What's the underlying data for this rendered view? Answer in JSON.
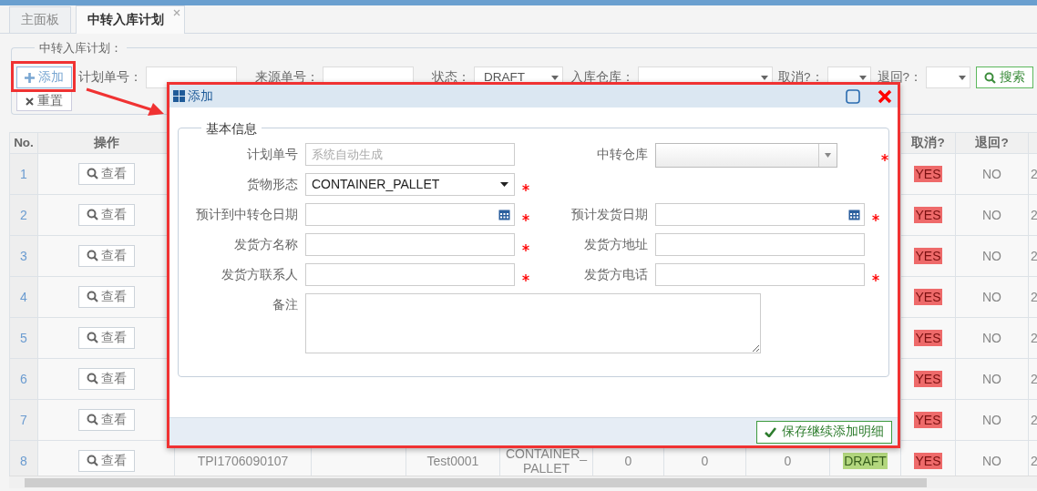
{
  "tabs": [
    {
      "label": "主面板",
      "selected": false,
      "closable": false
    },
    {
      "label": "中转入库计划",
      "selected": true,
      "closable": true
    }
  ],
  "filter": {
    "legend": "中转入库计划：",
    "add_button": "添加",
    "reset_button": "重置",
    "search_button": "搜索",
    "fields": [
      {
        "label": "计划单号：",
        "kind": "text"
      },
      {
        "label": "来源单号：",
        "kind": "text"
      },
      {
        "label": "状态：",
        "kind": "select",
        "value": "DRAFT"
      },
      {
        "label": "入库仓库：",
        "kind": "select"
      },
      {
        "label": "取消?：",
        "kind": "select"
      },
      {
        "label": "退回?：",
        "kind": "select"
      }
    ]
  },
  "table": {
    "columns": [
      "No.",
      "操作",
      "取消?",
      "退回?"
    ],
    "rows": [
      {
        "no": "1",
        "action": "查看",
        "cancelled": {
          "text": "YES",
          "color": "#ee6a6a"
        },
        "returned": {
          "text": "NO"
        },
        "column_13": "2"
      },
      {
        "no": "2",
        "action": "查看",
        "cancelled": {
          "text": "YES",
          "color": "#ee6a6a"
        },
        "returned": {
          "text": "NO"
        },
        "column_13": "2"
      },
      {
        "no": "3",
        "action": "查看",
        "cancelled": {
          "text": "YES",
          "color": "#ee6a6a"
        },
        "returned": {
          "text": "NO"
        },
        "column_13": "2"
      },
      {
        "no": "4",
        "action": "查看",
        "cancelled": {
          "text": "YES",
          "color": "#ee6a6a"
        },
        "returned": {
          "text": "NO"
        },
        "column_13": "2"
      },
      {
        "no": "5",
        "action": "查看",
        "cancelled": {
          "text": "YES",
          "color": "#ee6a6a"
        },
        "returned": {
          "text": "NO"
        },
        "column_13": "2"
      },
      {
        "no": "6",
        "action": "查看",
        "cancelled": {
          "text": "YES",
          "color": "#ee6a6a"
        },
        "returned": {
          "text": "NO"
        },
        "column_13": "2"
      },
      {
        "no": "7",
        "action": "查看",
        "cancelled": {
          "text": "YES",
          "color": "#ee6a6a"
        },
        "returned": {
          "text": "NO"
        },
        "column_13": "2"
      },
      {
        "no": "8",
        "action": "查看",
        "column_3": "TPI1706090107",
        "column_5": "Test0001",
        "column_6": "CONTAINER_PALLET",
        "column_7": "0",
        "column_8": "0",
        "column_9": "0",
        "column_10": {
          "text": "DRAFT",
          "color": "#b3d77e"
        },
        "cancelled": {
          "text": "YES",
          "color": "#ee6a6a"
        },
        "returned": {
          "text": "NO"
        },
        "column_13": "2"
      }
    ]
  },
  "dialog": {
    "title": "添加",
    "section": "基本信息",
    "rows": [
      {
        "left": {
          "label": "计划单号",
          "kind": "text",
          "placeholder": "系统自动生成",
          "required": false
        },
        "right": {
          "label": "中转仓库",
          "kind": "combo",
          "required": true
        }
      },
      {
        "left": {
          "label": "货物形态",
          "kind": "select",
          "value": "CONTAINER_PALLET",
          "required": true
        }
      },
      {
        "left": {
          "label": "预计到中转仓日期",
          "kind": "date",
          "required": true
        },
        "right": {
          "label": "预计发货日期",
          "kind": "date",
          "required": true
        }
      },
      {
        "left": {
          "label": "发货方名称",
          "kind": "text",
          "required": true
        },
        "right": {
          "label": "发货方地址",
          "kind": "text",
          "required": false
        }
      },
      {
        "left": {
          "label": "发货方联系人",
          "kind": "text",
          "required": true
        },
        "right": {
          "label": "发货方电话",
          "kind": "text",
          "required": true
        }
      },
      {
        "left": {
          "label": "备注",
          "kind": "textarea",
          "required": false
        }
      }
    ],
    "save_button": "保存继续添加明细"
  }
}
